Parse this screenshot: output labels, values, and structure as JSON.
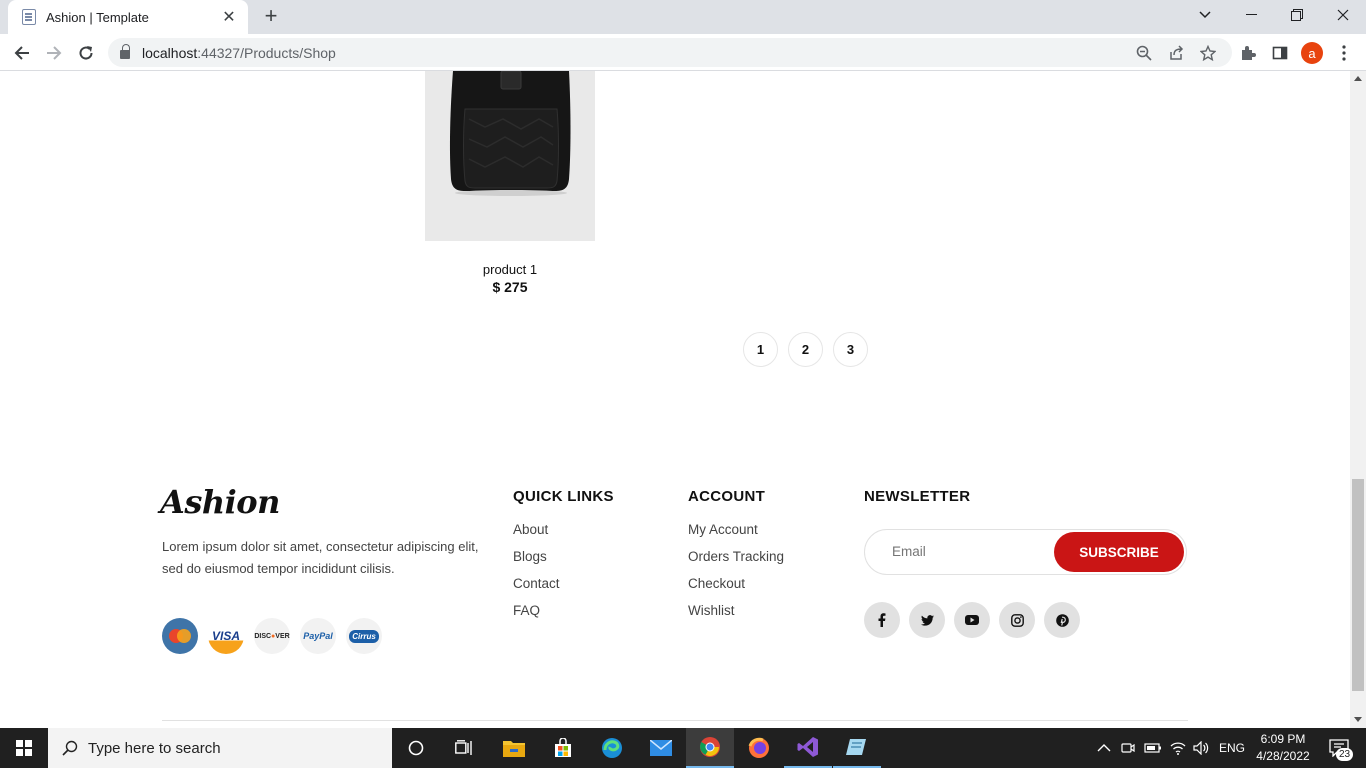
{
  "browser": {
    "tab_title": "Ashion | Template",
    "url_host": "localhost",
    "url_rest": ":44327/Products/Shop",
    "profile_initial": "a"
  },
  "product": {
    "name": "product 1",
    "price": "$ 275"
  },
  "pagination": [
    "1",
    "2",
    "3"
  ],
  "footer": {
    "logo": "Ashion",
    "description": "Lorem ipsum dolor sit amet, consectetur adipiscing elit, sed do eiusmod tempor incididunt cilisis.",
    "payments": [
      "MasterCard",
      "VISA",
      "DISCOVER",
      "PayPal",
      "Cirrus"
    ],
    "quick_links": {
      "title": "QUICK LINKS",
      "items": [
        "About",
        "Blogs",
        "Contact",
        "FAQ"
      ]
    },
    "account": {
      "title": "ACCOUNT",
      "items": [
        "My Account",
        "Orders Tracking",
        "Checkout",
        "Wishlist"
      ]
    },
    "newsletter": {
      "title": "NEWSLETTER",
      "placeholder": "Email",
      "button": "SUBSCRIBE"
    },
    "social": [
      "facebook-icon",
      "twitter-icon",
      "youtube-icon",
      "instagram-icon",
      "pinterest-icon"
    ]
  },
  "taskbar": {
    "search_placeholder": "Type here to search",
    "language": "ENG",
    "time": "6:09 PM",
    "date": "4/28/2022",
    "notification_count": "23"
  },
  "colors": {
    "accent": "#ca1515",
    "taskbar": "#202020"
  }
}
